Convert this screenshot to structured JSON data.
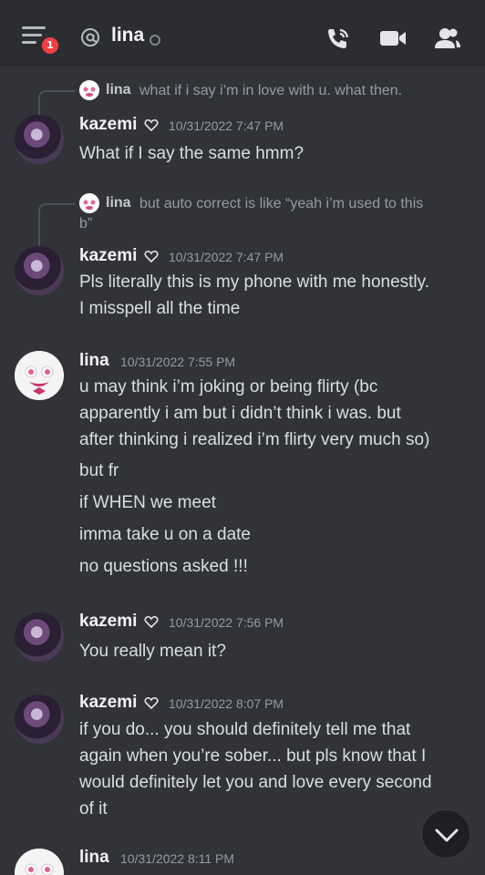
{
  "header": {
    "notification_count": "1",
    "channel_name": "lina",
    "icons": [
      "menu-icon",
      "at-icon",
      "call-icon",
      "video-icon",
      "members-icon"
    ]
  },
  "colors": {
    "background": "#313338",
    "header_bg": "#2b2d31",
    "badge_red": "#f23f43",
    "muted": "#949ba4"
  },
  "messages": [
    {
      "reply": {
        "name": "lina",
        "text": "what if i say i’m in love with u. what then."
      },
      "author": "kazemi",
      "timestamp": "10/31/2022 7:47 PM",
      "lines": [
        "What if I say the same hmm?"
      ]
    },
    {
      "reply": {
        "name": "lina",
        "text_line1": "but auto correct is like “yeah i’m used to this",
        "text_line2": "b”"
      },
      "author": "kazemi",
      "timestamp": "10/31/2022 7:47 PM",
      "lines": [
        "Pls literally this is my phone with me honestly.",
        "I misspell all the time"
      ]
    },
    {
      "author": "lina",
      "timestamp": "10/31/2022 7:55 PM",
      "lines": [
        "u may think i’m joking or being flirty (bc",
        "apparently i am but i didn’t think i was. but",
        "after thinking i realized i’m flirty very much so)",
        "but fr",
        "if WHEN we meet",
        "imma take u on a date",
        "no questions asked !!!"
      ]
    },
    {
      "author": "kazemi",
      "timestamp": "10/31/2022 7:56 PM",
      "lines": [
        "You really mean it?"
      ]
    },
    {
      "author": "kazemi",
      "timestamp": "10/31/2022 8:07 PM",
      "lines": [
        "if you do... you should definitely tell me that",
        "again when you’re sober... but pls know that I",
        "would definitely let you and love every second",
        "of it"
      ]
    },
    {
      "author": "lina",
      "timestamp": "10/31/2022 8:11 PM",
      "lines": []
    }
  ]
}
